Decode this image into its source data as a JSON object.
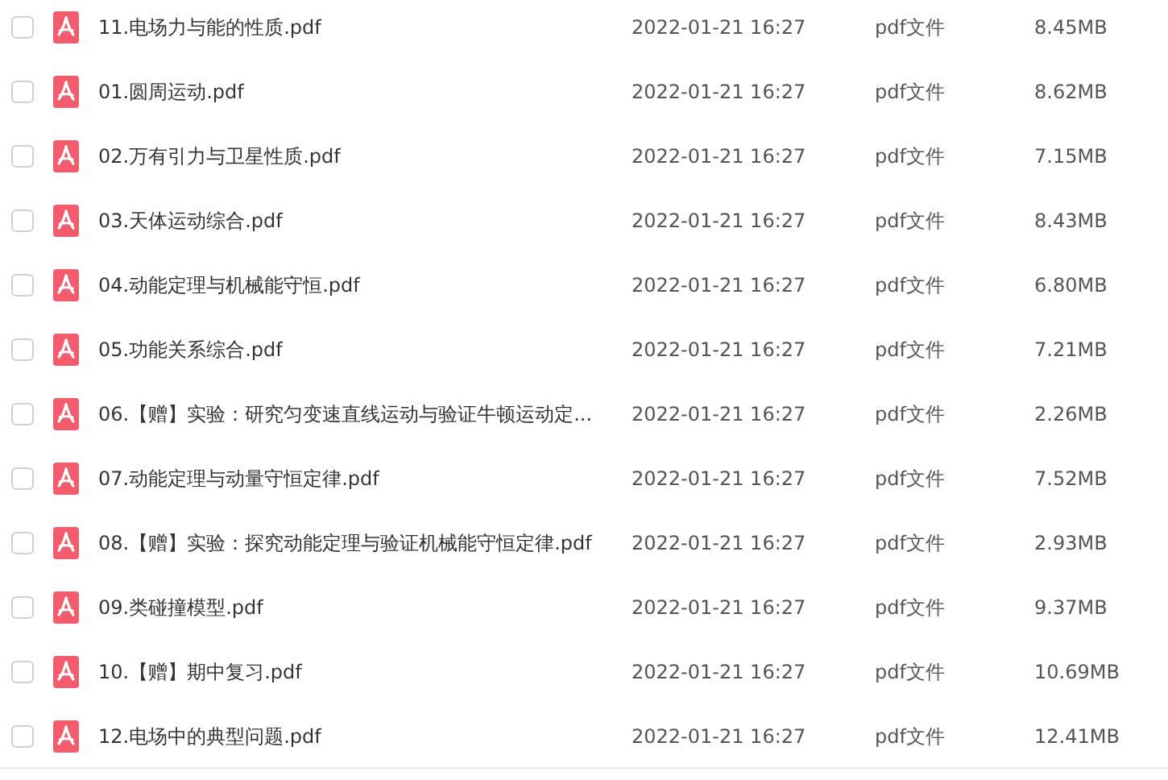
{
  "files": [
    {
      "name": "11.电场力与能的性质.pdf",
      "modified": "2022-01-21 16:27",
      "type": "pdf文件",
      "size": "8.45MB",
      "checked": false
    },
    {
      "name": "01.圆周运动.pdf",
      "modified": "2022-01-21 16:27",
      "type": "pdf文件",
      "size": "8.62MB",
      "checked": false
    },
    {
      "name": "02.万有引力与卫星性质.pdf",
      "modified": "2022-01-21 16:27",
      "type": "pdf文件",
      "size": "7.15MB",
      "checked": false
    },
    {
      "name": "03.天体运动综合.pdf",
      "modified": "2022-01-21 16:27",
      "type": "pdf文件",
      "size": "8.43MB",
      "checked": false
    },
    {
      "name": "04.动能定理与机械能守恒.pdf",
      "modified": "2022-01-21 16:27",
      "type": "pdf文件",
      "size": "6.80MB",
      "checked": false
    },
    {
      "name": "05.功能关系综合.pdf",
      "modified": "2022-01-21 16:27",
      "type": "pdf文件",
      "size": "7.21MB",
      "checked": false
    },
    {
      "name": "06.【赠】实验：研究匀变速直线运动与验证牛顿运动定...",
      "modified": "2022-01-21 16:27",
      "type": "pdf文件",
      "size": "2.26MB",
      "checked": false
    },
    {
      "name": "07.动能定理与动量守恒定律.pdf",
      "modified": "2022-01-21 16:27",
      "type": "pdf文件",
      "size": "7.52MB",
      "checked": false
    },
    {
      "name": "08.【赠】实验：探究动能定理与验证机械能守恒定律.pdf",
      "modified": "2022-01-21 16:27",
      "type": "pdf文件",
      "size": "2.93MB",
      "checked": false
    },
    {
      "name": "09.类碰撞模型.pdf",
      "modified": "2022-01-21 16:27",
      "type": "pdf文件",
      "size": "9.37MB",
      "checked": false
    },
    {
      "name": "10.【赠】期中复习.pdf",
      "modified": "2022-01-21 16:27",
      "type": "pdf文件",
      "size": "10.69MB",
      "checked": false
    },
    {
      "name": "12.电场中的典型问题.pdf",
      "modified": "2022-01-21 16:27",
      "type": "pdf文件",
      "size": "12.41MB",
      "checked": false
    }
  ]
}
